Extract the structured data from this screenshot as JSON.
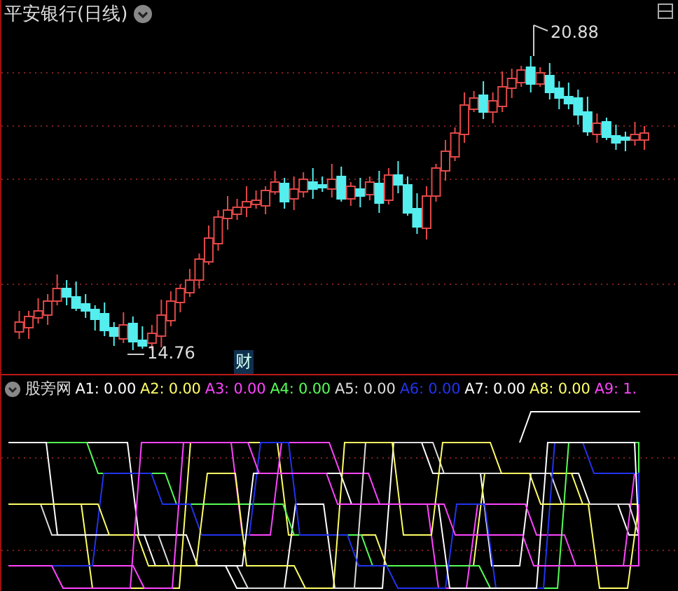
{
  "chart": {
    "title": "平安银行(日线)",
    "high_label": "20.88",
    "low_label": "14.76",
    "event_marker": "财"
  },
  "indicator": {
    "name": "股旁网",
    "values": [
      {
        "label": "A1:",
        "value": "0.00",
        "color": "#ffffff"
      },
      {
        "label": "A2:",
        "value": "0.00",
        "color": "#ffff66"
      },
      {
        "label": "A3:",
        "value": "0.00",
        "color": "#ff44ff"
      },
      {
        "label": "A4:",
        "value": "0.00",
        "color": "#55ff55"
      },
      {
        "label": "A5:",
        "value": "0.00",
        "color": "#dddddd"
      },
      {
        "label": "A6:",
        "value": "0.00",
        "color": "#2233ee"
      },
      {
        "label": "A7:",
        "value": "0.00",
        "color": "#ffffff"
      },
      {
        "label": "A8:",
        "value": "0.00",
        "color": "#ffff66"
      },
      {
        "label": "A9:",
        "value": "1.",
        "color": "#ff44ff"
      }
    ]
  }
}
